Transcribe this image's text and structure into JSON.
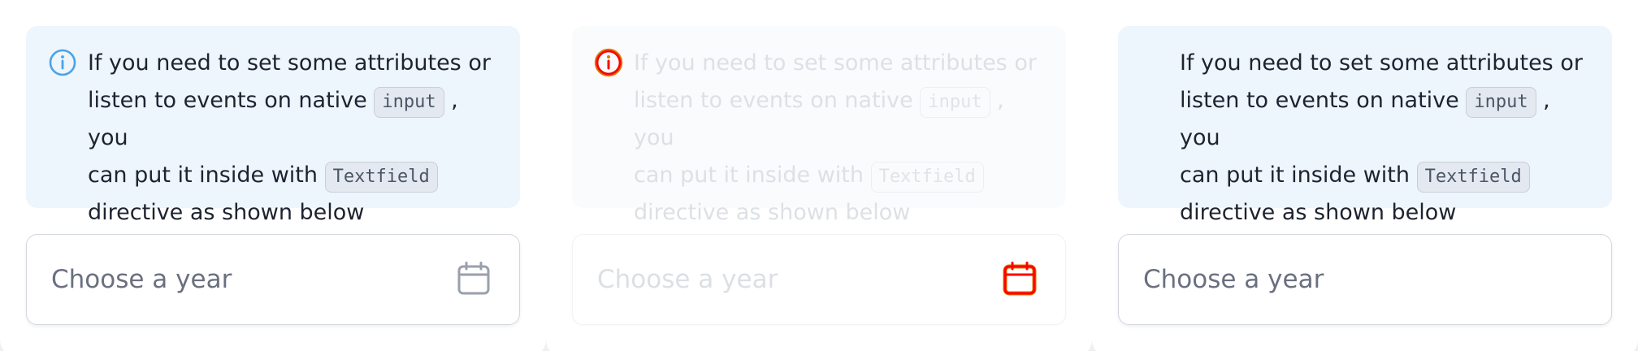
{
  "notice": {
    "line1": "If you need to set some attributes or",
    "line2_pre": "listen to events on native",
    "code1": "input",
    "line2_post": ", you",
    "line3_pre": "can put it inside with",
    "code2": "Textfield",
    "line4": "directive as shown below"
  },
  "year_field": {
    "placeholder": "Choose a year"
  },
  "icons": {
    "info": "info-circle-icon",
    "calendar": "calendar-icon"
  },
  "colors": {
    "info_blue": "#4aa3e8",
    "highlight_red": "#ff0000",
    "highlight_orange": "#e07b00",
    "callout_bg": "#edf5fd",
    "calendar_gray": "#9aa0ab"
  }
}
